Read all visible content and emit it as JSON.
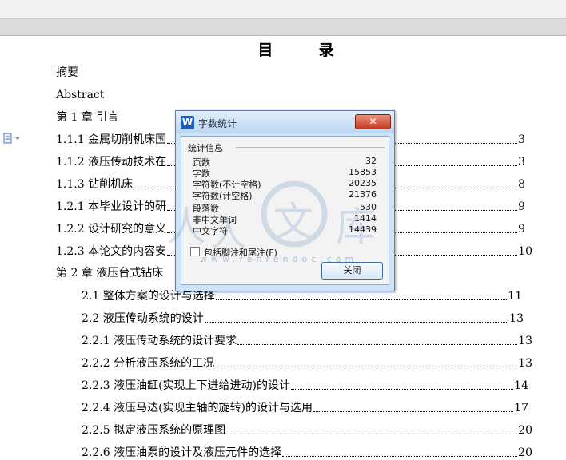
{
  "toc": {
    "title_char1": "目",
    "title_char2": "录",
    "plain_lines": [
      "摘要",
      "Abstract",
      "第 1 章  引言",
      "第 2 章  液压台式钻床"
    ],
    "entries": [
      {
        "text": "1.1.1 金属切削机床国",
        "page": "3"
      },
      {
        "text": "1.1.2 液压传动技术在",
        "page": "3"
      },
      {
        "text": "1.1.3 钻削机床",
        "page": "8"
      },
      {
        "text": "1.2.1 本毕业设计的研",
        "page": "9"
      },
      {
        "text": "1.2.2 设计研究的意义",
        "page": "9"
      },
      {
        "text": "1.2.3 本论文的内容安",
        "page": "10"
      },
      {
        "text": "2.1 整体方案的设计与选择",
        "page": "11"
      },
      {
        "text": "2.2 液压传动系统的设计",
        "page": "13"
      },
      {
        "text": "2.2.1 液压传动系统的设计要求",
        "page": "13"
      },
      {
        "text": "2.2.2 分析液压系统的工况",
        "page": "13"
      },
      {
        "text": "2.2.3 液压油缸(实现上下进给进动)的设计",
        "page": "14"
      },
      {
        "text": "2.2.4 液压马达(实现主轴的旋转)的设计与选用",
        "page": "17"
      },
      {
        "text": "2.2.5 拟定液压系统的原理图",
        "page": "20"
      },
      {
        "text": "2.2.6 液压油泵的设计及液压元件的选择",
        "page": "20"
      }
    ]
  },
  "dialog": {
    "title": "字数统计",
    "logo": "W",
    "close_label": "关闭",
    "group_label": "统计信息",
    "stats": [
      {
        "label": "页数",
        "value": "32"
      },
      {
        "label": "字数",
        "value": "15853"
      },
      {
        "label": "字符数(不计空格)",
        "value": "20235"
      },
      {
        "label": "字符数(计空格)",
        "value": "21376"
      },
      {
        "label": "段落数",
        "value": "530"
      },
      {
        "label": "非中文单词",
        "value": "1414"
      },
      {
        "label": "中文字符",
        "value": "14439"
      }
    ],
    "checkbox_label": "包括脚注和尾注(F)",
    "ok_label": "关闭"
  },
  "watermark": {
    "chars": [
      "人",
      "人",
      "文",
      "库"
    ],
    "url": "www.renrendoc.com"
  },
  "colors": {
    "dialog_bg": "#cfe3f7",
    "close_red": "#c53d20",
    "watermark_blue": "#1e5fa8"
  }
}
